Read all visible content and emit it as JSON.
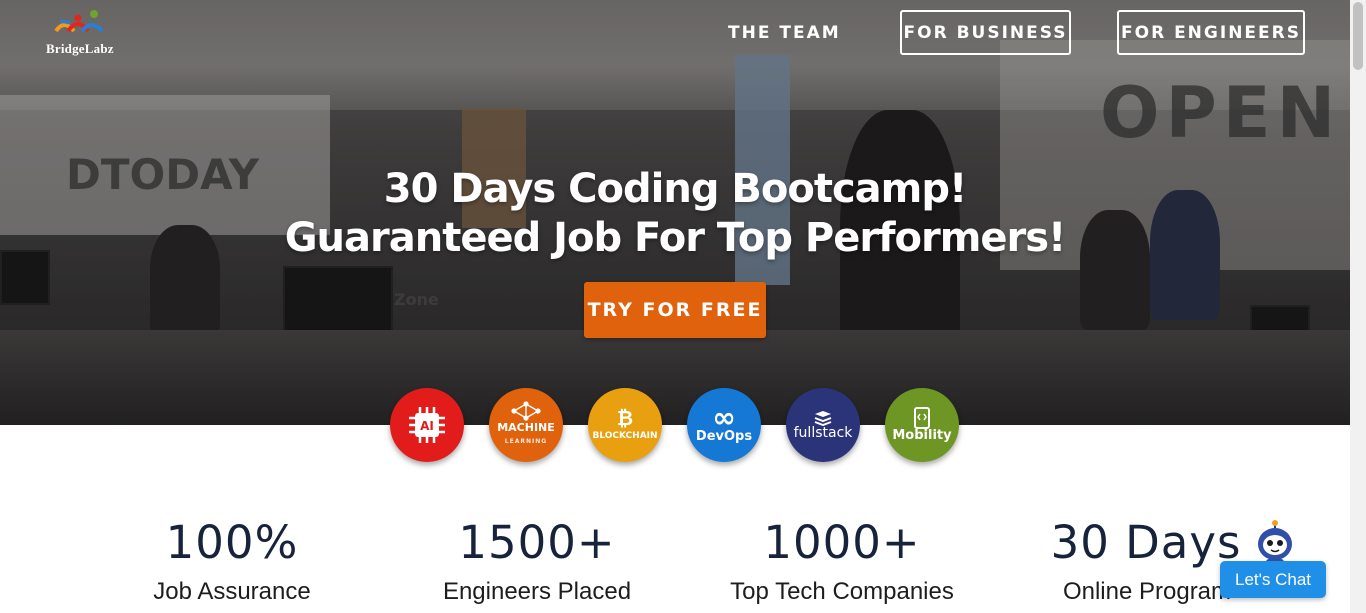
{
  "logo": {
    "text": "BridgeLabz"
  },
  "nav": {
    "team": "THE TEAM",
    "business": "FOR BUSINESS",
    "engineers": "FOR ENGINEERS"
  },
  "hero": {
    "headline_1": "30 Days Coding Bootcamp!",
    "headline_2": "Guaranteed Job For Top Performers!",
    "cta": "TRY FOR FREE",
    "wall_text_left": "DTODAY",
    "wall_text_right": "OPEN",
    "wall_text_zone": "Zone"
  },
  "courses": [
    {
      "icon": "ai-chip-icon",
      "label": "AI",
      "color": "#e21b1b"
    },
    {
      "icon": "neural-network-icon",
      "label": "MACHINE",
      "sublabel": "LEARNING",
      "color": "#e0620d"
    },
    {
      "icon": "bitcoin-icon",
      "label": "BLOCKCHAIN",
      "color": "#e8a010"
    },
    {
      "icon": "infinity-icon",
      "label": "DevOps",
      "color": "#1478d4"
    },
    {
      "icon": "stack-layers-icon",
      "label": "fullstack",
      "color": "#2b3478"
    },
    {
      "icon": "mobile-code-icon",
      "label": "Mobility",
      "color": "#6e9625"
    }
  ],
  "stats": [
    {
      "value": "100%",
      "label": "Job Assurance"
    },
    {
      "value": "1500+",
      "label": "Engineers Placed"
    },
    {
      "value": "1000+",
      "label": "Top Tech Companies"
    },
    {
      "value": "30 Days",
      "label": "Online Program"
    }
  ],
  "chat": {
    "label": "Let's Chat"
  },
  "colors": {
    "accent_orange": "#e0620d",
    "stat_navy": "#17233b",
    "chat_blue": "#1f8fe8"
  }
}
